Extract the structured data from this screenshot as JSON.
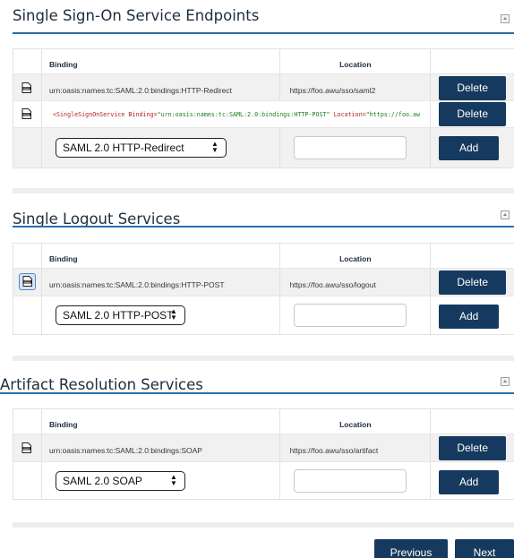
{
  "sso": {
    "title": "Single Sign-On Service Endpoints",
    "header": {
      "binding": "Binding",
      "location": "Location"
    },
    "rows": [
      {
        "binding": "urn:oasis:names:tc:SAML:2.0:bindings:HTTP-Redirect",
        "location": "https://foo.awu/sso/saml2",
        "action": "Delete"
      }
    ],
    "xml_row": {
      "tag": "<SingleSignOnService",
      "attr1": " Binding=",
      "val1": "\"urn:oasis:names:tc:SAML:2.0:bindings:HTTP-POST\"",
      "attr2": " Location=",
      "val2": "\"https://foo.aw",
      "action": "Delete"
    },
    "add_row": {
      "select_value": "SAML 2.0 HTTP-Redirect",
      "location_value": "",
      "action": "Add"
    }
  },
  "slo": {
    "title": "Single Logout Services",
    "header": {
      "binding": "Binding",
      "location": "Location"
    },
    "rows": [
      {
        "binding": "urn:oasis:names:tc:SAML:2.0:bindings:HTTP-POST",
        "location": "https://foo.awu/sso/logout",
        "action": "Delete"
      }
    ],
    "add_row": {
      "select_value": "SAML 2.0 HTTP-POST",
      "location_value": "",
      "action": "Add"
    }
  },
  "ars": {
    "title": "Artifact Resolution Services",
    "header": {
      "binding": "Binding",
      "location": "Location"
    },
    "rows": [
      {
        "binding": "urn:oasis:names:tc:SAML:2.0:bindings:SOAP",
        "location": "https://foo.awu/sso/artifact",
        "action": "Delete"
      }
    ],
    "add_row": {
      "select_value": "SAML 2.0 SOAP",
      "location_value": "",
      "action": "Add"
    }
  },
  "nav": {
    "previous": "Previous",
    "next": "Next"
  },
  "icons": {
    "xml_doc": "xml-document-icon",
    "collapse": "collapse-icon",
    "select_arrows": "updown-arrows-icon"
  },
  "colors": {
    "accent": "#163a5f",
    "rule": "#2a6fa8"
  }
}
